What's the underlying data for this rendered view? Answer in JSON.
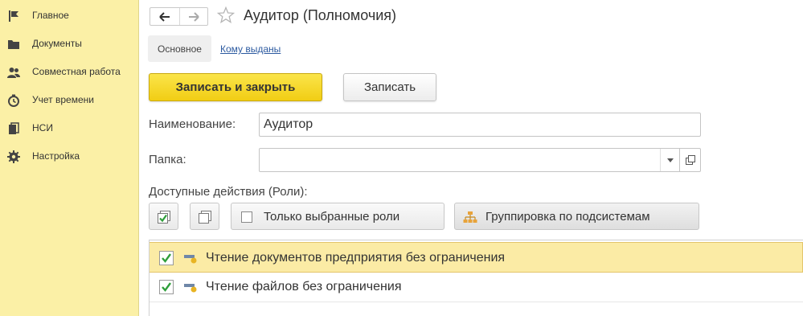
{
  "sidebar": {
    "items": [
      {
        "label": "Главное",
        "icon": "flag-icon"
      },
      {
        "label": "Документы",
        "icon": "folder-icon"
      },
      {
        "label": "Совместная работа",
        "icon": "users-icon"
      },
      {
        "label": "Учет времени",
        "icon": "clock-icon"
      },
      {
        "label": "НСИ",
        "icon": "book-icon"
      },
      {
        "label": "Настройка",
        "icon": "gear-icon"
      }
    ]
  },
  "header": {
    "title": "Аудитор (Полномочия)"
  },
  "tabs": {
    "main": "Основное",
    "link": "Кому выданы"
  },
  "toolbar": {
    "save_close_label": "Записать и закрыть",
    "save_label": "Записать"
  },
  "form": {
    "name_label": "Наименование:",
    "name_value": "Аудитор",
    "folder_label": "Папка:",
    "folder_value": "",
    "actions_label": "Доступные действия (Роли):"
  },
  "roles_toolbar": {
    "only_selected_label": "Только выбранные роли",
    "group_by_label": "Группировка по подсистемам"
  },
  "roles": [
    {
      "label": "Чтение документов предприятия без ограничения",
      "checked": true,
      "selected": true
    },
    {
      "label": "Чтение файлов без ограничения",
      "checked": true,
      "selected": false
    }
  ],
  "colors": {
    "sidebar_bg": "#fbf0a6",
    "primary_button": "#f1cd14",
    "selected_row": "#fbeba5",
    "check_green": "#2e9e3a",
    "link": "#2c5aa0"
  }
}
